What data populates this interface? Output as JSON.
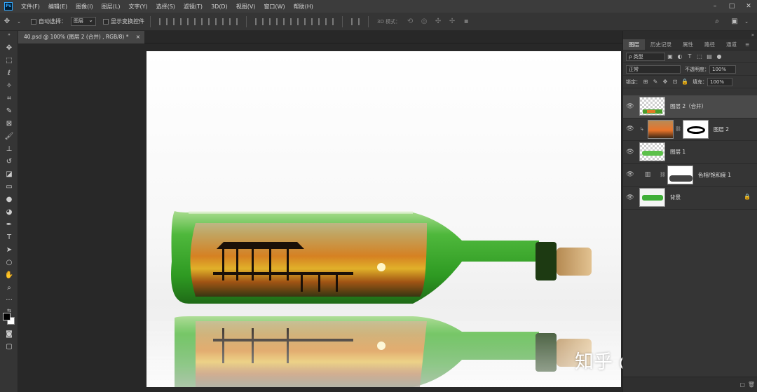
{
  "menubar": {
    "logo": "Ps",
    "items": [
      "文件(F)",
      "编辑(E)",
      "图像(I)",
      "图层(L)",
      "文字(Y)",
      "选择(S)",
      "滤镜(T)",
      "3D(D)",
      "视图(V)",
      "窗口(W)",
      "帮助(H)"
    ],
    "window_controls": [
      "–",
      "□",
      "✕"
    ]
  },
  "options": {
    "auto_select_label": "自动选择：",
    "auto_select_value": "图层",
    "show_transform_label": "显示变换控件",
    "mode_3d_label": "3D 模式："
  },
  "document_tab": {
    "title": "40.psd @ 100% (图层 2 (合并) , RGB/8) *",
    "close": "×"
  },
  "layers_panel": {
    "tabs": [
      "图层",
      "历史记录",
      "属性",
      "路径",
      "通道"
    ],
    "filter_kind": "ρ 类型",
    "blend_mode": "正常",
    "opacity_label": "不透明度：",
    "opacity_value": "100%",
    "lock_label": "锁定：",
    "fill_label": "填充：",
    "fill_value": "100%",
    "layers": [
      {
        "name": "图层 2（合并）",
        "selected": true
      },
      {
        "name": "图层 2",
        "selected": false
      },
      {
        "name": "图层 1",
        "selected": false
      },
      {
        "name": "色相/饱和度 1",
        "selected": false
      },
      {
        "name": "背景",
        "selected": false
      }
    ]
  },
  "watermark": "知乎 @江南烟雨",
  "colors": {
    "accent": "#31a8ff",
    "panel_bg": "#353535",
    "workspace_bg": "#282828"
  }
}
